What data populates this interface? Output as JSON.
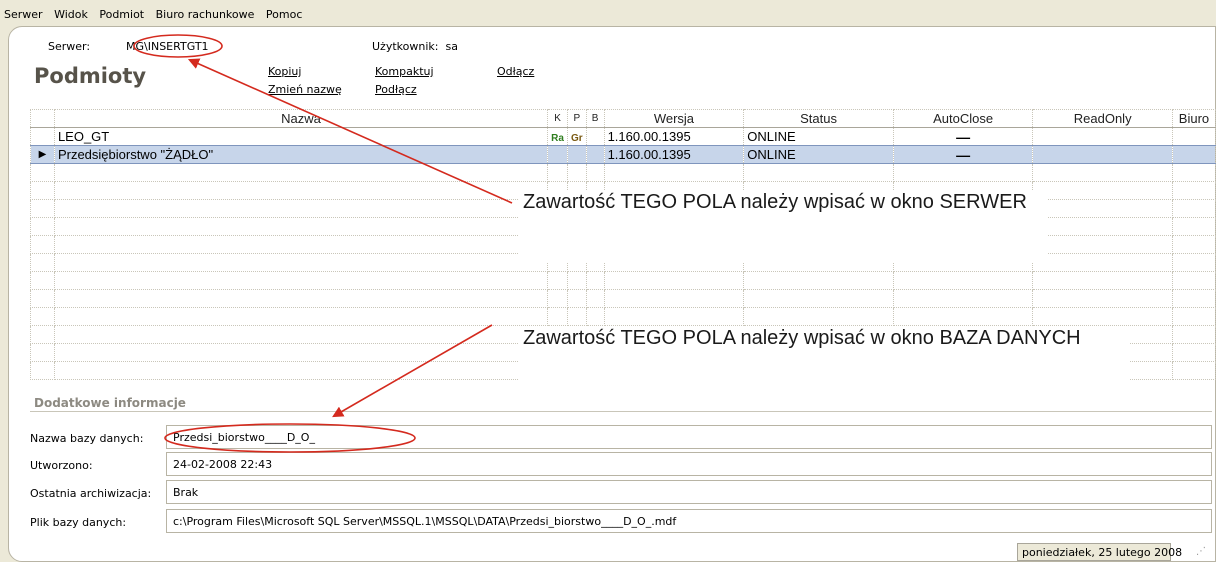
{
  "menu": {
    "items": [
      "Serwer",
      "Widok",
      "Podmiot",
      "Biuro rachunkowe",
      "Pomoc"
    ]
  },
  "infobar": {
    "server_label": "Serwer:",
    "server_value": "MG\\INSERTGT1",
    "user_label": "Użytkownik:",
    "user_value": "sa"
  },
  "title": "Podmioty",
  "actions": {
    "kopiuj": "Kopiuj",
    "zmien": "Zmień nazwę",
    "kompaktuj": "Kompaktuj",
    "podlacz": "Podłącz",
    "odlacz": "Odłącz"
  },
  "table": {
    "headers": {
      "nazwa": "Nazwa",
      "k": "K",
      "p": "P",
      "b": "B",
      "wersja": "Wersja",
      "status": "Status",
      "autoclose": "AutoClose",
      "readonly": "ReadOnly",
      "biuro": "Biuro"
    },
    "rows": [
      {
        "indicator": "",
        "nazwa": "LEO_GT",
        "k": "Ra",
        "p": "Gr",
        "wersja": "1.160.00.1395",
        "status": "ONLINE",
        "autoclose": "—"
      },
      {
        "indicator": "▶",
        "nazwa": "Przedsiębiorstwo \"ŻĄDŁO\"",
        "k": "",
        "p": "",
        "wersja": "1.160.00.1395",
        "status": "ONLINE",
        "autoclose": "—"
      }
    ]
  },
  "annotations": {
    "server_note": "Zawartość TEGO POLA należy wpisać w okno SERWER",
    "db_note": "Zawartość TEGO POLA należy wpisać w okno BAZA DANYCH"
  },
  "details": {
    "title": "Dodatkowe informacje",
    "nazwa_label": "Nazwa bazy danych:",
    "nazwa_value": "Przedsi_biorstwo____D_O_",
    "utworzono_label": "Utworzono:",
    "utworzono_value": "24-02-2008 22:43",
    "archiwizacja_label": "Ostatnia archiwizacja:",
    "archiwizacja_value": "Brak",
    "plik_label": "Plik bazy danych:",
    "plik_value": "c:\\Program Files\\Microsoft SQL Server\\MSSQL.1\\MSSQL\\DATA\\Przedsi_biorstwo____D_O_.mdf"
  },
  "status": {
    "date": "poniedziałek, 25 lutego 2008"
  },
  "colors": {
    "selection": "#c7d5ea",
    "annotation": "#d42a1e",
    "badge_ra": "#2e7d1e",
    "badge_gr": "#7a5a12"
  }
}
